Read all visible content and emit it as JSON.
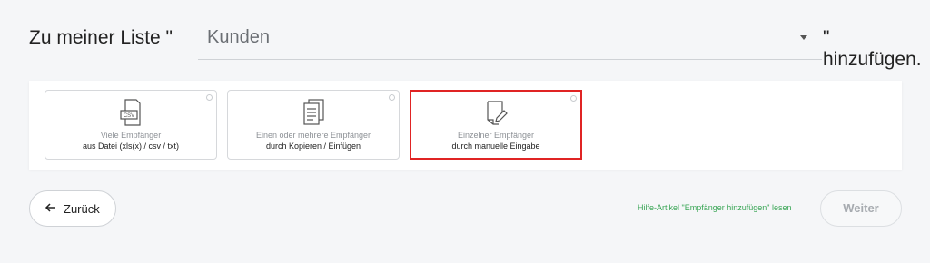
{
  "header": {
    "prefix": "Zu meiner Liste \"",
    "list_value": "Kunden",
    "suffix": "\" hinzufügen."
  },
  "options": [
    {
      "line1": "Viele Empfänger",
      "line2": "aus Datei (xls(x) / csv / txt)",
      "icon": "csv-file-icon",
      "icon_text": "CSV",
      "selected": false
    },
    {
      "line1": "Einen oder mehrere Empfänger",
      "line2": "durch Kopieren / Einfügen",
      "icon": "document-list-icon",
      "selected": false
    },
    {
      "line1": "Einzelner Empfänger",
      "line2": "durch manuelle Eingabe",
      "icon": "edit-document-icon",
      "selected": true
    }
  ],
  "footer": {
    "back_label": "Zurück",
    "help_link": "Hilfe-Artikel \"Empfänger hinzufügen\" lesen",
    "next_label": "Weiter"
  },
  "colors": {
    "selection_border": "#e02424",
    "help_link": "#3aa656",
    "background": "#f5f6f8"
  }
}
